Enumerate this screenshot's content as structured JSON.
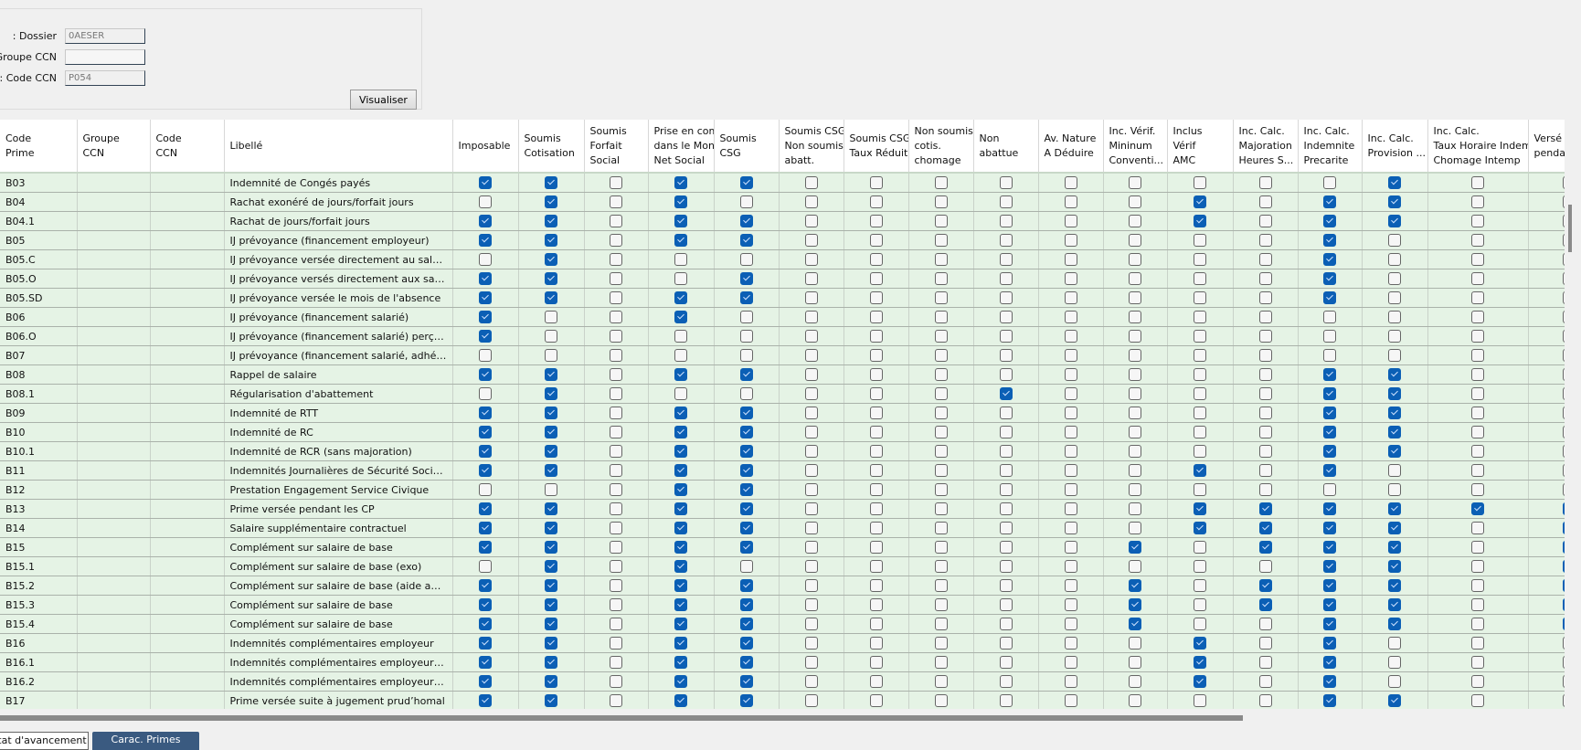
{
  "filters": {
    "dossier_label": "Dossier :",
    "dossier_value": "0AESER",
    "groupe_label": "Groupe CCN :",
    "groupe_value": "",
    "code_label": "Code CCN :",
    "code_value": "P054",
    "visualiser_label": "Visualiser"
  },
  "columns": [
    "Code\nPrime",
    "Groupe\nCCN",
    "Code\nCCN",
    "Libellé",
    "Imposable",
    "Soumis\nCotisation",
    "Soumis\nForfait\nSocial",
    "Prise en com\ndans le Mont\nNet Social",
    "Soumis\nCSG",
    "Soumis CSG\nNon soumise\nabatt.",
    "Soumis CSG\nTaux Réduit",
    "Non soumis\ncotis.\nchomage",
    "Non\nabattue",
    "Av. Nature\nA Déduire",
    "Inc. Vérif.\nMininum\nConventi...",
    "Inclus\nVérif\nAMC",
    "Inc. Calc.\nMajoration\nHeures S...",
    "Inc. Calc.\nIndemnite\nPrecarite",
    "Inc. Calc.\nProvision ...",
    "Inc. Calc.\nTaux Horaire Indem\nChomage Intemp",
    "Versé\npenda"
  ],
  "rows": [
    {
      "code": "B03",
      "groupe": "",
      "ccn": "",
      "libelle": "Indemnité de Congés payés",
      "flags": [
        1,
        1,
        0,
        1,
        1,
        0,
        0,
        0,
        0,
        0,
        0,
        0,
        0,
        0,
        1,
        0,
        0
      ]
    },
    {
      "code": "B04",
      "groupe": "",
      "ccn": "",
      "libelle": "Rachat exonéré de jours/forfait jours",
      "flags": [
        0,
        1,
        0,
        1,
        0,
        0,
        0,
        0,
        0,
        0,
        0,
        1,
        0,
        1,
        1,
        0,
        0
      ]
    },
    {
      "code": "B04.1",
      "groupe": "",
      "ccn": "",
      "libelle": "Rachat de jours/forfait jours",
      "flags": [
        1,
        1,
        0,
        1,
        1,
        0,
        0,
        0,
        0,
        0,
        0,
        1,
        0,
        1,
        1,
        0,
        0
      ]
    },
    {
      "code": "B05",
      "groupe": "",
      "ccn": "",
      "libelle": "IJ prévoyance (financement employeur)",
      "flags": [
        1,
        1,
        0,
        1,
        1,
        0,
        0,
        0,
        0,
        0,
        0,
        0,
        0,
        1,
        0,
        0,
        0
      ]
    },
    {
      "code": "B05.C",
      "groupe": "",
      "ccn": "",
      "libelle": "IJ prévoyance versée directement au salarié (...",
      "flags": [
        0,
        1,
        0,
        0,
        0,
        0,
        0,
        0,
        0,
        0,
        0,
        0,
        0,
        1,
        0,
        0,
        0
      ]
    },
    {
      "code": "B05.O",
      "groupe": "",
      "ccn": "",
      "libelle": "IJ prévoyance versés directement aux salariés",
      "flags": [
        1,
        1,
        0,
        0,
        1,
        0,
        0,
        0,
        0,
        0,
        0,
        0,
        0,
        1,
        0,
        0,
        0
      ]
    },
    {
      "code": "B05.SD",
      "groupe": "",
      "ccn": "",
      "libelle": "IJ prévoyance versée le mois de l'absence",
      "flags": [
        1,
        1,
        0,
        1,
        1,
        0,
        0,
        0,
        0,
        0,
        0,
        0,
        0,
        1,
        0,
        0,
        0
      ]
    },
    {
      "code": "B06",
      "groupe": "",
      "ccn": "",
      "libelle": "IJ prévoyance (financement salarié)",
      "flags": [
        1,
        0,
        0,
        1,
        0,
        0,
        0,
        0,
        0,
        0,
        0,
        0,
        0,
        0,
        0,
        0,
        0
      ]
    },
    {
      "code": "B06.O",
      "groupe": "",
      "ccn": "",
      "libelle": "IJ prévoyance (financement salarié) perçues/...",
      "flags": [
        1,
        0,
        0,
        0,
        0,
        0,
        0,
        0,
        0,
        0,
        0,
        0,
        0,
        0,
        0,
        0,
        0
      ]
    },
    {
      "code": "B07",
      "groupe": "",
      "ccn": "",
      "libelle": "IJ prévoyance (financement salarié, adhésion ...",
      "flags": [
        0,
        0,
        0,
        0,
        0,
        0,
        0,
        0,
        0,
        0,
        0,
        0,
        0,
        0,
        0,
        0,
        0
      ]
    },
    {
      "code": "B08",
      "groupe": "",
      "ccn": "",
      "libelle": "Rappel de salaire",
      "flags": [
        1,
        1,
        0,
        1,
        1,
        0,
        0,
        0,
        0,
        0,
        0,
        0,
        0,
        1,
        1,
        0,
        0
      ]
    },
    {
      "code": "B08.1",
      "groupe": "",
      "ccn": "",
      "libelle": "Régularisation d'abattement",
      "flags": [
        0,
        1,
        0,
        0,
        0,
        0,
        0,
        0,
        1,
        0,
        0,
        0,
        0,
        1,
        1,
        0,
        0
      ]
    },
    {
      "code": "B09",
      "groupe": "",
      "ccn": "",
      "libelle": "Indemnité de RTT",
      "flags": [
        1,
        1,
        0,
        1,
        1,
        0,
        0,
        0,
        0,
        0,
        0,
        0,
        0,
        1,
        1,
        0,
        0
      ]
    },
    {
      "code": "B10",
      "groupe": "",
      "ccn": "",
      "libelle": "Indemnité de RC",
      "flags": [
        1,
        1,
        0,
        1,
        1,
        0,
        0,
        0,
        0,
        0,
        0,
        0,
        0,
        1,
        1,
        0,
        0
      ]
    },
    {
      "code": "B10.1",
      "groupe": "",
      "ccn": "",
      "libelle": "Indemnité de RCR (sans majoration)",
      "flags": [
        1,
        1,
        0,
        1,
        1,
        0,
        0,
        0,
        0,
        0,
        0,
        0,
        0,
        1,
        1,
        0,
        0
      ]
    },
    {
      "code": "B11",
      "groupe": "",
      "ccn": "",
      "libelle": "Indemnités Journalières de Sécurité Sociale",
      "flags": [
        1,
        1,
        0,
        1,
        1,
        0,
        0,
        0,
        0,
        0,
        0,
        1,
        0,
        1,
        0,
        0,
        0
      ]
    },
    {
      "code": "B12",
      "groupe": "",
      "ccn": "",
      "libelle": "Prestation Engagement Service Civique",
      "flags": [
        0,
        0,
        0,
        1,
        1,
        0,
        0,
        0,
        0,
        0,
        0,
        0,
        0,
        0,
        0,
        0,
        0
      ]
    },
    {
      "code": "B13",
      "groupe": "",
      "ccn": "",
      "libelle": "Prime versée pendant les CP",
      "flags": [
        1,
        1,
        0,
        1,
        1,
        0,
        0,
        0,
        0,
        0,
        0,
        1,
        1,
        1,
        1,
        1,
        1
      ]
    },
    {
      "code": "B14",
      "groupe": "",
      "ccn": "",
      "libelle": "Salaire supplémentaire contractuel",
      "flags": [
        1,
        1,
        0,
        1,
        1,
        0,
        0,
        0,
        0,
        0,
        0,
        1,
        1,
        1,
        1,
        0,
        1
      ]
    },
    {
      "code": "B15",
      "groupe": "",
      "ccn": "",
      "libelle": "Complément sur salaire de base",
      "flags": [
        1,
        1,
        0,
        1,
        1,
        0,
        0,
        0,
        0,
        0,
        1,
        0,
        1,
        1,
        1,
        0,
        1
      ]
    },
    {
      "code": "B15.1",
      "groupe": "",
      "ccn": "",
      "libelle": "Complément sur salaire de base (exo)",
      "flags": [
        0,
        1,
        0,
        1,
        0,
        0,
        0,
        0,
        0,
        0,
        0,
        0,
        0,
        1,
        1,
        0,
        1
      ]
    },
    {
      "code": "B15.2",
      "groupe": "",
      "ccn": "",
      "libelle": "Complément sur salaire de base (aide au poste)",
      "flags": [
        1,
        1,
        0,
        1,
        1,
        0,
        0,
        0,
        0,
        0,
        1,
        0,
        1,
        1,
        1,
        0,
        1
      ]
    },
    {
      "code": "B15.3",
      "groupe": "",
      "ccn": "",
      "libelle": "Complément sur salaire de base",
      "flags": [
        1,
        1,
        0,
        1,
        1,
        0,
        0,
        0,
        0,
        0,
        1,
        0,
        1,
        1,
        1,
        0,
        1
      ]
    },
    {
      "code": "B15.4",
      "groupe": "",
      "ccn": "",
      "libelle": "Complément sur salaire de base",
      "flags": [
        1,
        1,
        0,
        1,
        1,
        0,
        0,
        0,
        0,
        0,
        1,
        0,
        0,
        1,
        1,
        0,
        1
      ]
    },
    {
      "code": "B16",
      "groupe": "",
      "ccn": "",
      "libelle": "Indemnités complémentaires employeur",
      "flags": [
        1,
        1,
        0,
        1,
        1,
        0,
        0,
        0,
        0,
        0,
        0,
        1,
        0,
        1,
        0,
        0,
        0
      ]
    },
    {
      "code": "B16.1",
      "groupe": "",
      "ccn": "",
      "libelle": "Indemnités complémentaires employeur (ajust...",
      "flags": [
        1,
        1,
        0,
        1,
        1,
        0,
        0,
        0,
        0,
        0,
        0,
        1,
        0,
        1,
        0,
        0,
        0
      ]
    },
    {
      "code": "B16.2",
      "groupe": "",
      "ccn": "",
      "libelle": "Indemnités complémentaires employeur (ajust...",
      "flags": [
        1,
        1,
        0,
        1,
        1,
        0,
        0,
        0,
        0,
        0,
        0,
        1,
        0,
        1,
        0,
        0,
        0
      ]
    },
    {
      "code": "B17",
      "groupe": "",
      "ccn": "",
      "libelle": "Prime versée suite à jugement prud’homal",
      "flags": [
        1,
        1,
        0,
        1,
        1,
        0,
        0,
        0,
        0,
        0,
        0,
        0,
        0,
        1,
        1,
        0,
        0
      ]
    }
  ],
  "tabs": [
    {
      "label": "État d'avancement",
      "active": false
    },
    {
      "label": "Carac. Primes",
      "active": true
    }
  ],
  "colors": {
    "checked": "#0b5fb5",
    "row_bg": "#e5f3e5",
    "active_tab": "#3a5a80"
  }
}
